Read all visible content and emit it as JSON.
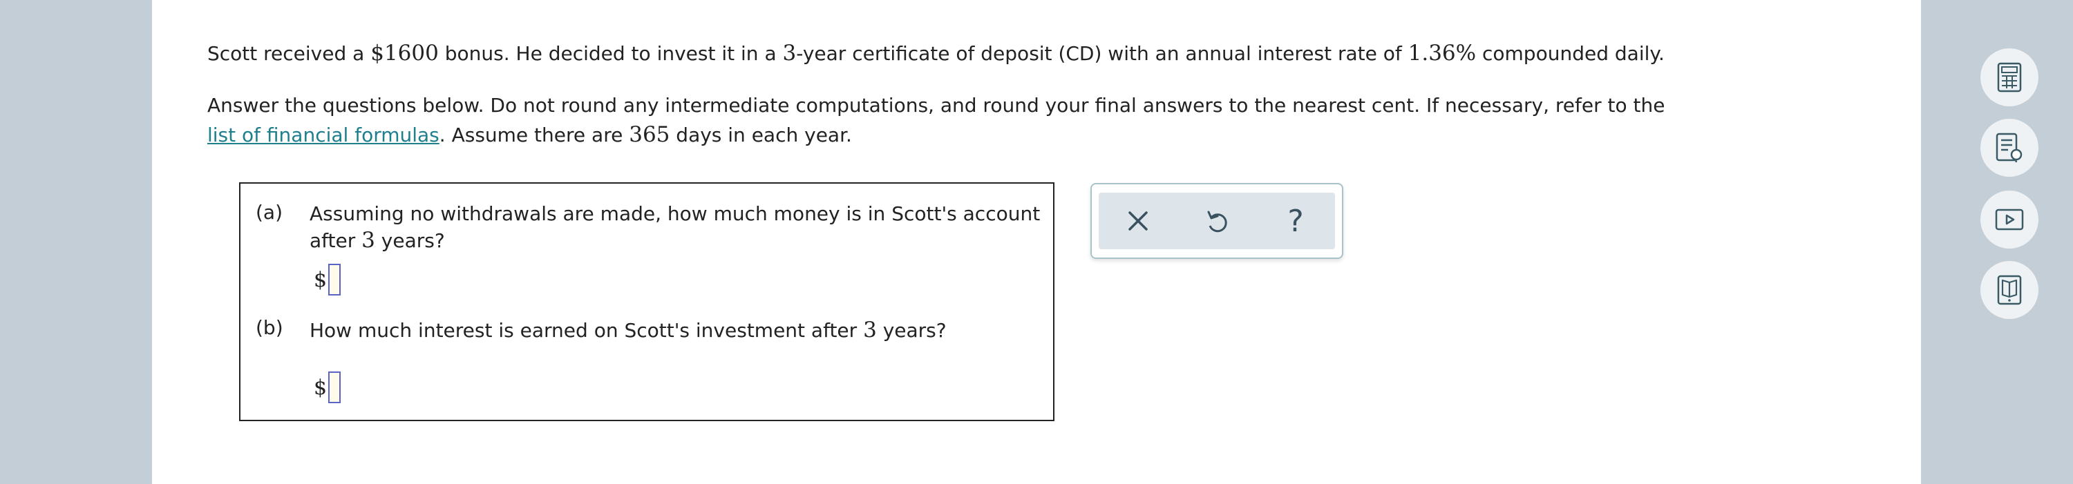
{
  "problem": {
    "line1": {
      "p1": "Scott received a ",
      "amount": "$1600",
      "p2": " bonus. He decided to invest it in a ",
      "years": "3",
      "p3": "-year certificate of deposit (CD) with an annual interest rate of ",
      "rate": "1.36%",
      "p4": " compounded daily."
    },
    "line2": "Answer the questions below. Do not round any intermediate computations, and round your final answers to the nearest cent. If necessary, refer to the",
    "line3": {
      "link": "list of financial formulas",
      "p1": ". Assume there are ",
      "days": "365",
      "p2": " days in each year."
    }
  },
  "questions": {
    "a": {
      "label": "(a)",
      "text_line1": "Assuming no withdrawals are made, how much money is in Scott's account",
      "text_line2_pre": "after ",
      "years": "3",
      "text_line2_post": " years?",
      "currency": "$",
      "value": ""
    },
    "b": {
      "label": "(b)",
      "text_pre": "How much interest is earned on Scott's investment after ",
      "years": "3",
      "text_post": " years?",
      "currency": "$",
      "value": ""
    }
  },
  "toolbox": {
    "help_label": "?"
  },
  "sidebar_tools": [
    "calculator-icon",
    "notes-icon",
    "video-icon",
    "ebook-icon"
  ]
}
